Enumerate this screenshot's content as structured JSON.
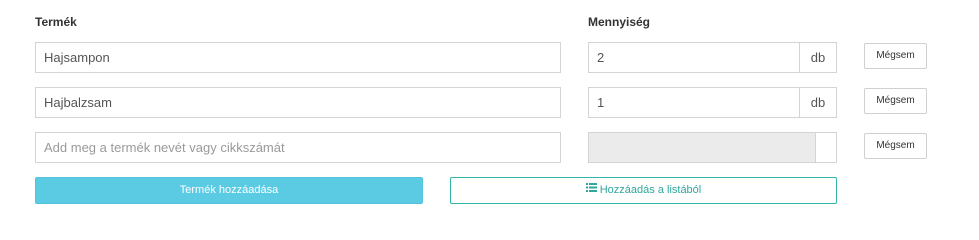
{
  "labels": {
    "product": "Termék",
    "quantity": "Mennyiség"
  },
  "rows": [
    {
      "product": "Hajsampon",
      "quantity": "2",
      "unit": "db",
      "cancel": "Mégsem"
    },
    {
      "product": "Hajbalzsam",
      "quantity": "1",
      "unit": "db",
      "cancel": "Mégsem"
    }
  ],
  "new_row": {
    "placeholder": "Add meg a termék nevét vagy cikkszámát",
    "cancel": "Mégsem"
  },
  "actions": {
    "add_product": "Termék hozzáadása",
    "add_from_list": "Hozzáadás a listából",
    "add_from_list_icon": "list-icon"
  },
  "colors": {
    "add_button": "#5bcbe3",
    "list_button_border": "#2fb5a9"
  }
}
